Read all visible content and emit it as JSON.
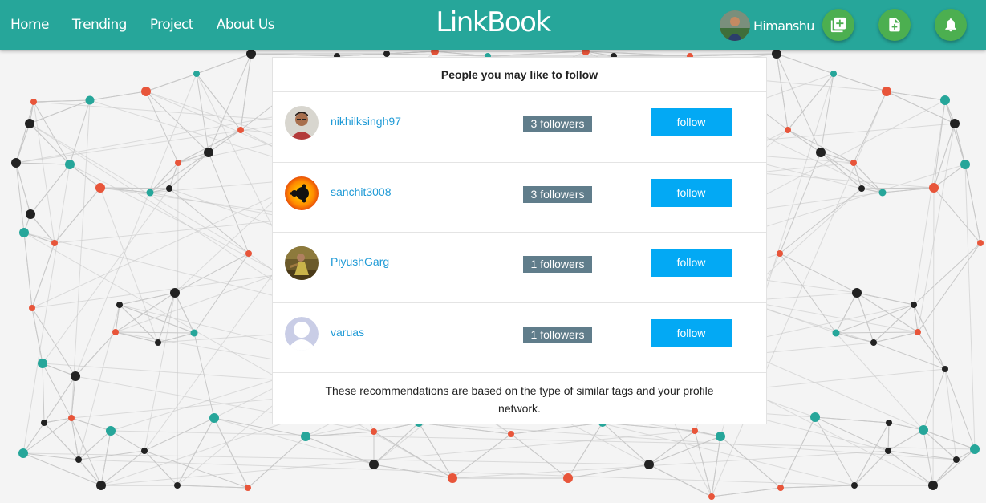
{
  "nav": {
    "links": [
      "Home",
      "Trending",
      "Project",
      "About Us"
    ],
    "brand": "LinkBook",
    "user_name": "Himanshu",
    "actions": [
      {
        "name": "add-collection-icon"
      },
      {
        "name": "add-document-icon"
      },
      {
        "name": "notification-bell-icon"
      }
    ]
  },
  "card": {
    "title": "People you may like to follow",
    "users": [
      {
        "username": "nikhilksingh97",
        "followers": "3 followers",
        "follow_label": "follow",
        "avatar": "person-photo"
      },
      {
        "username": "sanchit3008",
        "followers": "3 followers",
        "follow_label": "follow",
        "avatar": "fractal-image"
      },
      {
        "username": "PiyushGarg",
        "followers": "1 followers",
        "follow_label": "follow",
        "avatar": "person-photo"
      },
      {
        "username": "varuas",
        "followers": "1 followers",
        "follow_label": "follow",
        "avatar": "default-avatar"
      }
    ],
    "footer": "These recommendations are based on the type of similar tags and your profile network."
  },
  "colors": {
    "navbar": "#26a69a",
    "fab": "#4caf50",
    "follow_button": "#03a9f4",
    "badge": "#607d8b",
    "link": "#1e9ad6"
  }
}
